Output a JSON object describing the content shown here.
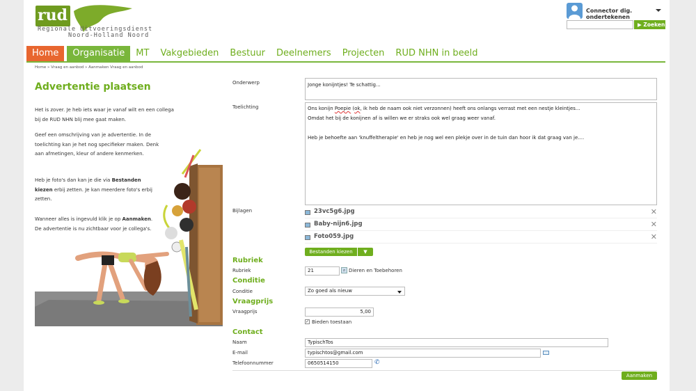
{
  "logo": {
    "mark": "rud",
    "line1": "Regionale Uitvoeringsdienst",
    "line2": "Noord-Holland Noord",
    "brand_green": "#6f9b1f"
  },
  "user": {
    "name": "Connector dig. ondertekenen",
    "avatar_icon": "user-icon"
  },
  "search": {
    "placeholder": "",
    "button_label": "Zoeken"
  },
  "nav": {
    "items": [
      {
        "label": "Home"
      },
      {
        "label": "Organisatie"
      },
      {
        "label": "MT"
      },
      {
        "label": "Vakgebieden"
      },
      {
        "label": "Bestuur"
      },
      {
        "label": "Deelnemers"
      },
      {
        "label": "Projecten"
      },
      {
        "label": "RUD NHN in beeld"
      }
    ],
    "home_color": "#e8662f",
    "active_color": "#79b63b"
  },
  "breadcrumb": "Home » Vraag en aanbod » Aanmaken Vraag en aanbod",
  "intro": {
    "title": "Advertentie plaatsen",
    "p1": "Het is zover. Je heb iets waar je vanaf wilt en een collega bij de RUD NHN blij mee gaat maken.",
    "p2": "Geef een omschrijving van je advertentie. In de toelichting kan je het nog specifieker maken. Denk aan afmetingen, kleur of andere kenmerken.",
    "p3a": "Heb je foto's dan kan je die via ",
    "p3b": "Bestanden kiezen",
    "p3c": " erbij zetten. Je kan meerdere foto's erbij zetten.",
    "p4a": "Wanneer alles is ingevuld klik je op ",
    "p4b": "Aanmaken",
    "p4c": ". De advertentie is nu zichtbaar voor je collega's."
  },
  "form": {
    "onderwerp_label": "Onderwerp",
    "onderwerp_value": "Jonge konijntjes! Te schattig...",
    "toelichting_label": "Toelichting",
    "toelichting_line1a": "Ons konijn ",
    "toelichting_line1b": "Poepie",
    "toelichting_line1c": " (",
    "toelichting_line1d": "ok",
    "toelichting_line1e": ", ik heb de naam ook niet verzonnen) heeft ons onlangs verrast met een nestje kleintjes...",
    "toelichting_line2": "Omdat het bij de konijnen af is willen we er straks ook wel graag weer vanaf.",
    "toelichting_line3": "Heb je behoefte aan 'knuffeltherapie' en heb je nog wel een plekje over in de tuin dan hoor ik dat graag van je....",
    "bijlagen_label": "Bijlagen",
    "attachments": [
      {
        "name": "23vc5g6.jpg"
      },
      {
        "name": "Baby-nijn6.jpg"
      },
      {
        "name": "Foto059.jpg"
      }
    ],
    "choose_files_label": "Bestanden kiezen",
    "rubriek_section": "Rubriek",
    "rubriek_label": "Rubriek",
    "rubriek_code": "21",
    "rubriek_name": "Dieren en Toebehoren",
    "conditie_section": "Conditie",
    "conditie_label": "Conditie",
    "conditie_value": "Zo goed als nieuw",
    "vraagprijs_section": "Vraagprijs",
    "vraagprijs_label": "Vraagprijs",
    "vraagprijs_value": "5,00",
    "bieden_label": "Bieden toestaan",
    "bieden_checked": true,
    "contact_section": "Contact",
    "naam_label": "Naam",
    "naam_value": "TypischTos",
    "email_label": "E-mail",
    "email_value": "typischtos@gmail.com",
    "telefoon_label": "Telefoonnummer",
    "telefoon_value": "0650514150",
    "submit_label": "Aanmaken"
  }
}
